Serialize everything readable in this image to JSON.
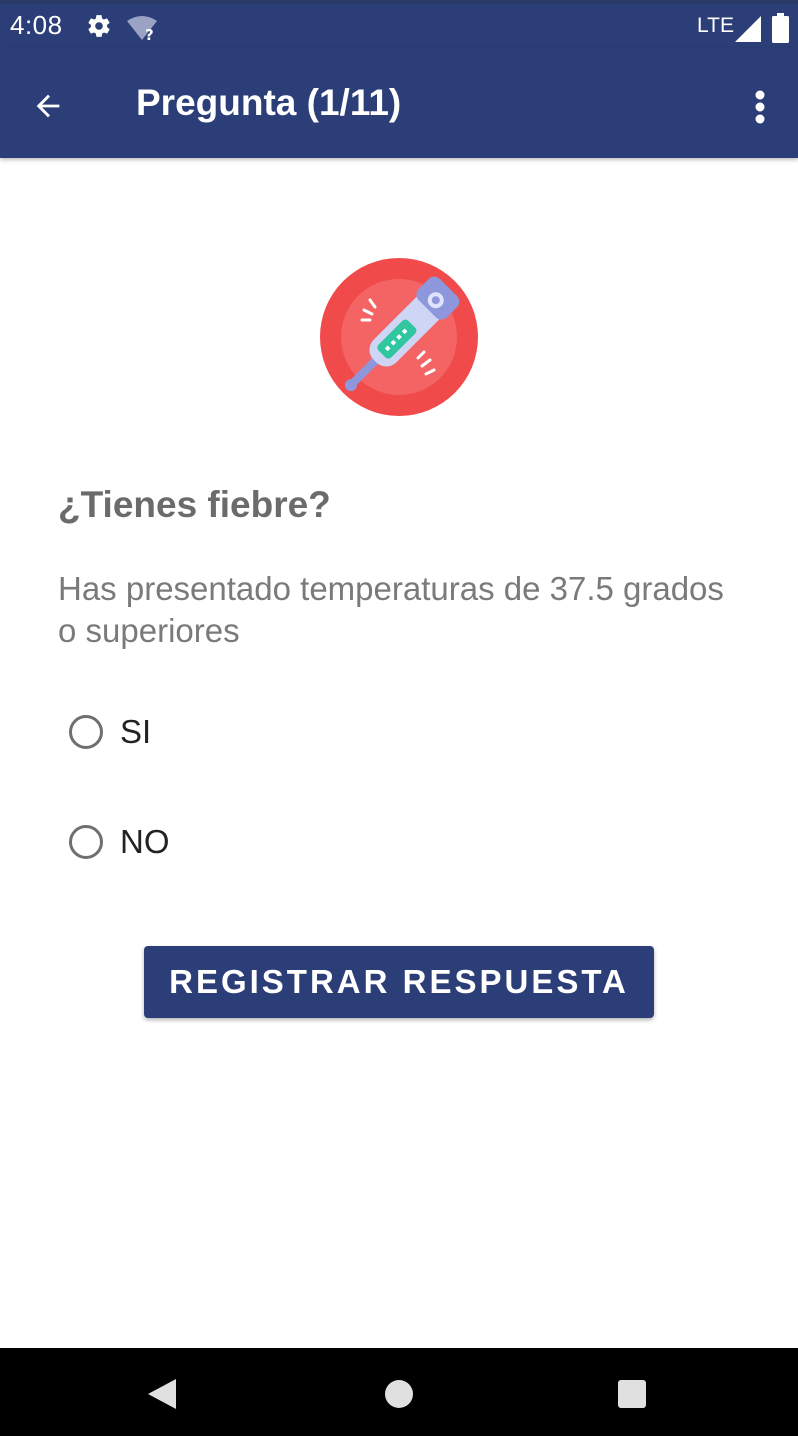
{
  "status_bar": {
    "time": "4:08",
    "network": "LTE",
    "icons": [
      "gear-icon",
      "wifi-unknown-icon",
      "signal-icon",
      "battery-icon"
    ]
  },
  "app_bar": {
    "title": "Pregunta (1/11)",
    "icons": [
      "back-arrow-icon",
      "more-vert-icon"
    ]
  },
  "question": {
    "illustration": "fever-thermometer-icon",
    "title": "¿Tienes fiebre?",
    "description": "Has presentado temperaturas de 37.5 grados o superiores"
  },
  "options": [
    {
      "label": "SI",
      "selected": false
    },
    {
      "label": "NO",
      "selected": false
    }
  ],
  "submit": {
    "label": "REGISTRAR RESPUESTA"
  },
  "nav_bar": {
    "icons": [
      "nav-back-icon",
      "nav-home-icon",
      "nav-recents-icon"
    ]
  },
  "colors": {
    "primary": "#2c3e78",
    "illustration_red": "#f04a4a",
    "thermometer_purple": "#8e97dc",
    "thermometer_green": "#2fc6a0"
  }
}
